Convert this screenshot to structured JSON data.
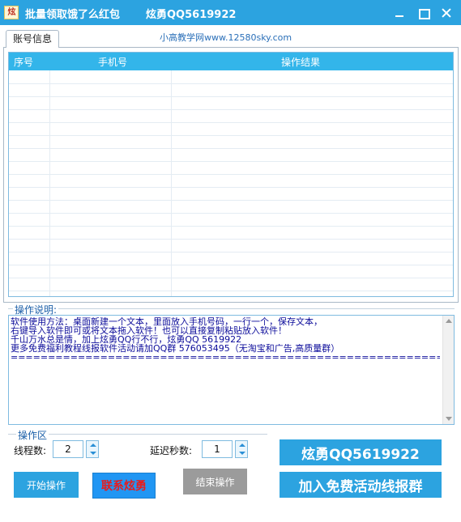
{
  "window": {
    "icon_text": "炫勇",
    "title": "批量领取饿了么红包",
    "title_contact": "炫勇QQ5619922"
  },
  "tab": {
    "label": "账号信息",
    "watermark": "小高教学网www.12580sky.com"
  },
  "table": {
    "columns": [
      "序号",
      "手机号",
      "操作结果"
    ],
    "rows": []
  },
  "instructions": {
    "legend": "操作说明:",
    "lines": [
      "软件使用方法：桌面新建一个文本，里面放入手机号码，一行一个，保存文本，",
      "右键导入软件即可或将文本拖入软件！也可以直接复制粘贴放入软件！",
      "千山万水总是情，加上炫勇QQ行不行，炫勇QQ 5619922",
      "更多免费福利教程线报软件活动请加QQ群 576053495（无淘宝和广告,高质量群）",
      "=============================================================="
    ]
  },
  "operation": {
    "legend": "操作区",
    "threads_label": "线程数:",
    "threads_value": "2",
    "delay_label": "延迟秒数:",
    "delay_value": "1",
    "start_label": "开始操作",
    "contact_label": "联系炫勇",
    "stop_label": "结束操作",
    "qq_label": "炫勇QQ5619922",
    "join_label": "加入免费活动线报群"
  },
  "colors": {
    "titlebar": "#2ca3e0",
    "header": "#33b5ea",
    "contact_text": "#e81c1c",
    "disabled": "#9b9b9b"
  }
}
